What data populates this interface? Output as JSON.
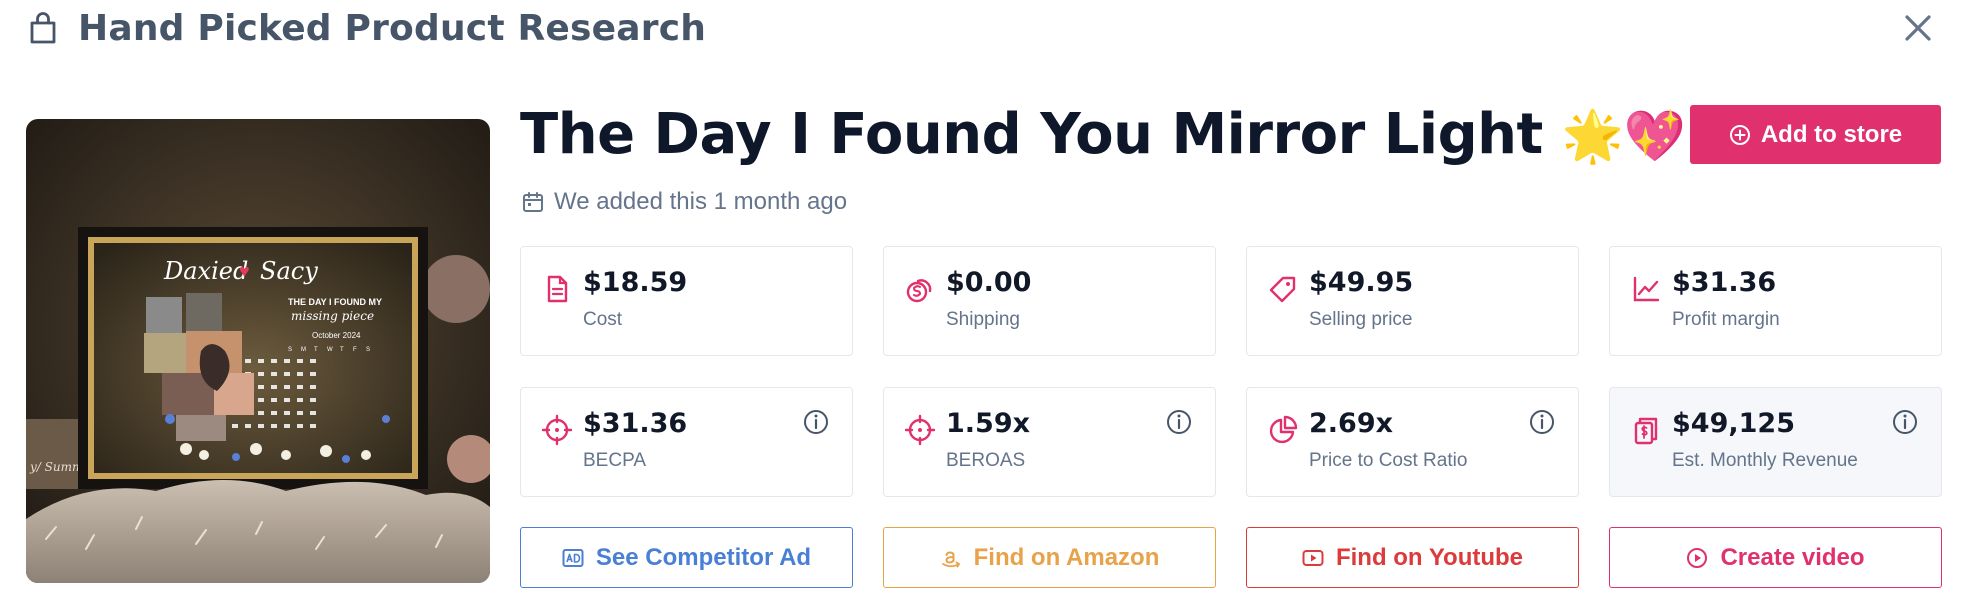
{
  "header": {
    "title": "Hand Picked Product Research"
  },
  "product": {
    "title": "The Day I Found You Mirror Light",
    "title_emoji": "🌟💖",
    "title_ellipsis": "...",
    "added_text": "We added this 1 month ago",
    "image_text": {
      "names_left": "Daxied",
      "names_right": "Sacy",
      "line1": "THE DAY I FOUND MY",
      "line2": "missing piece",
      "month": "October 2024",
      "weekdays": [
        "S",
        "M",
        "T",
        "W",
        "T",
        "F",
        "S"
      ],
      "side_text": "y/ Summ"
    }
  },
  "add_button": {
    "label": "Add to store"
  },
  "metrics": [
    {
      "value": "$18.59",
      "label": "Cost",
      "icon": "document-icon"
    },
    {
      "value": "$0.00",
      "label": "Shipping",
      "icon": "coins-icon"
    },
    {
      "value": "$49.95",
      "label": "Selling price",
      "icon": "tag-icon"
    },
    {
      "value": "$31.36",
      "label": "Profit margin",
      "icon": "trend-icon"
    },
    {
      "value": "$31.36",
      "label": "BECPA",
      "icon": "crosshair-icon"
    },
    {
      "value": "1.59x",
      "label": "BEROAS",
      "icon": "crosshair-icon"
    },
    {
      "value": "2.69x",
      "label": "Price to Cost Ratio",
      "icon": "pie-icon"
    },
    {
      "value": "$49,125",
      "label": "Est. Monthly Revenue",
      "icon": "money-icon"
    }
  ],
  "actions": [
    {
      "label": "See Competitor Ad",
      "color": "#4a7fd6"
    },
    {
      "label": "Find on Amazon",
      "color": "#e7a24a"
    },
    {
      "label": "Find on Youtube",
      "color": "#dc3b3b"
    },
    {
      "label": "Create video",
      "color": "#e0316e"
    }
  ],
  "colors": {
    "accent": "#e0316e",
    "muted": "#64748b",
    "heading": "#475569"
  }
}
